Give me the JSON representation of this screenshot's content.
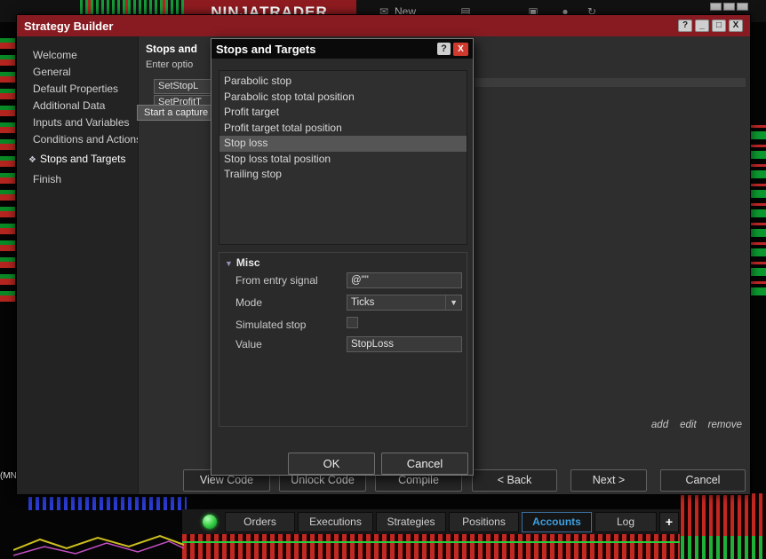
{
  "colors": {
    "brand_red": "#8e1b20",
    "titlebar_red": "#871b21",
    "close_button_red": "#d03a2e",
    "active_tab_blue": "#3f9fe0",
    "connection_green": "#2ecc40"
  },
  "app": {
    "logo": "NINJATRADER",
    "menu_new_label": "New",
    "chart_axis_label": "(MN"
  },
  "strategy_builder": {
    "title": "Strategy Builder",
    "titlebar_buttons": {
      "help": "?",
      "minimize": "_",
      "maximize": "□",
      "close": "X"
    },
    "sidebar": [
      "Welcome",
      "General",
      "Default Properties",
      "Additional Data",
      "Inputs and Variables",
      "Conditions and Actions",
      "Stops and Targets",
      "Finish"
    ],
    "selected_item": "Stops and Targets",
    "selected_item_marker": "❖",
    "content": {
      "heading": "Stops and",
      "description": "Enter optio",
      "button1": "SetStopL",
      "button2": "SetProfitT"
    },
    "links": {
      "add": "add",
      "edit": "edit",
      "remove": "remove"
    },
    "footer": {
      "view_code": "View Code",
      "unlock_code": "Unlock Code",
      "compile": "Compile",
      "back": "< Back",
      "next": "Next >",
      "cancel": "Cancel"
    }
  },
  "tooltip": {
    "text": "Start a capture"
  },
  "dialog": {
    "title": "Stops and Targets",
    "titlebar_buttons": {
      "help": "?",
      "close": "X"
    },
    "list": [
      "Parabolic stop",
      "Parabolic stop total position",
      "Profit target",
      "Profit target total position",
      "Stop loss",
      "Stop loss total position",
      "Trailing stop"
    ],
    "selected_item": "Stop loss",
    "misc": {
      "header": "Misc",
      "expander": "▼",
      "rows": [
        {
          "label": "From entry signal",
          "value": "@\"\""
        },
        {
          "label": "Mode",
          "value": "Ticks"
        },
        {
          "label": "Simulated stop",
          "value": ""
        },
        {
          "label": "Value",
          "value": "StopLoss"
        }
      ]
    },
    "ok": "OK",
    "cancel": "Cancel"
  },
  "status_bar": {
    "tabs": [
      "Orders",
      "Executions",
      "Strategies",
      "Positions",
      "Accounts",
      "Log"
    ],
    "active_tab": "Accounts",
    "add_tab": "+"
  }
}
